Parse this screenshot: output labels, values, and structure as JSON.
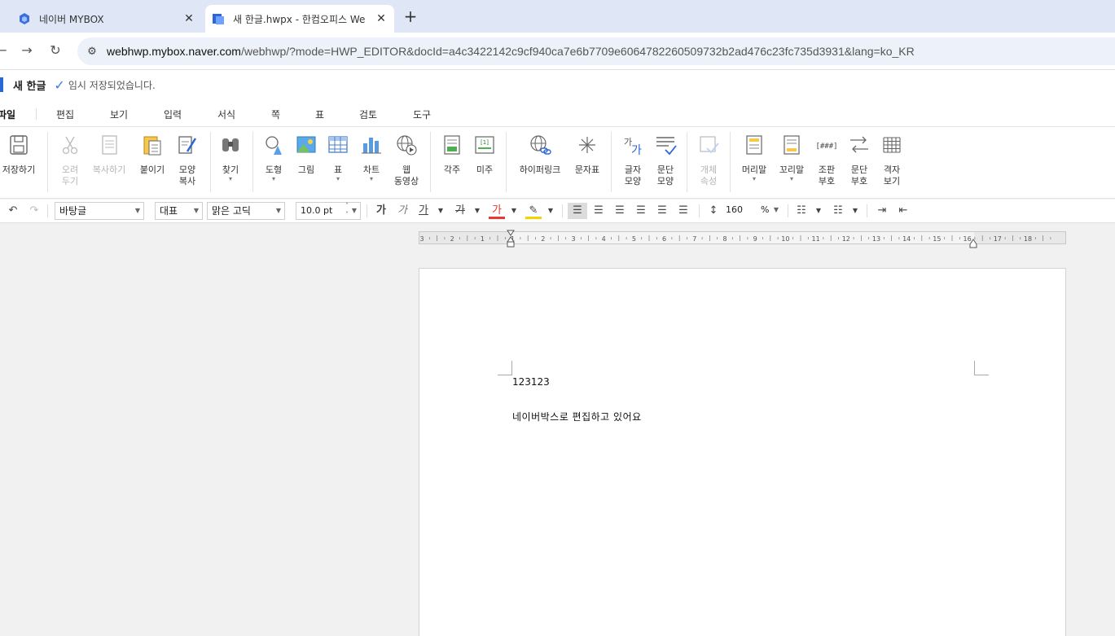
{
  "browser": {
    "tabs": [
      {
        "title": "네이버 MYBOX",
        "active": false
      },
      {
        "title": "새 한글.hwpx - 한컴오피스 We",
        "active": true
      }
    ],
    "url_host": "webhwp.mybox.naver.com",
    "url_rest": "/webhwp/?mode=HWP_EDITOR&docId=a4c3422142c9cf940ca7e6b7709e6064782260509732b2ad476c23fc735d3931&lang=ko_KR"
  },
  "app": {
    "doc_title": "새 한글",
    "save_status": "임시 저장되었습니다."
  },
  "menu": [
    "파일",
    "편집",
    "보기",
    "입력",
    "서식",
    "쪽",
    "표",
    "검토",
    "도구"
  ],
  "ribbon": {
    "save": "저장하기",
    "cut": "오려\n두기",
    "copy": "복사하기",
    "paste": "붙이기",
    "format_copy": "모양\n복사",
    "find": "찾기",
    "shape": "도형",
    "picture": "그림",
    "table": "표",
    "chart": "차트",
    "web_video": "웹\n동영상",
    "footnote": "각주",
    "endnote": "미주",
    "hyperlink": "하이퍼링크",
    "char_map": "문자표",
    "char_shape": "글자\n모양",
    "para_shape": "문단\n모양",
    "object_props": "개체\n속성",
    "header": "머리말",
    "footer": "꼬리말",
    "outline_num": "조판\n부호",
    "para_num": "문단\n부호",
    "grid_view": "격자\n보기"
  },
  "format": {
    "style": "바탕글",
    "lang": "대표",
    "font": "맑은 고딕",
    "size": "10.0",
    "size_unit": "pt",
    "line_spacing": "160",
    "line_spacing_unit": "%"
  },
  "ruler_ticks": [
    "3",
    "2",
    "1",
    "1",
    "2",
    "3",
    "4",
    "5",
    "6",
    "7",
    "8",
    "9",
    "10",
    "11",
    "12",
    "13",
    "14",
    "15",
    "16",
    "17",
    "18"
  ],
  "document": {
    "lines": [
      "123123",
      "네이버박스로 편집하고 있어요"
    ]
  }
}
